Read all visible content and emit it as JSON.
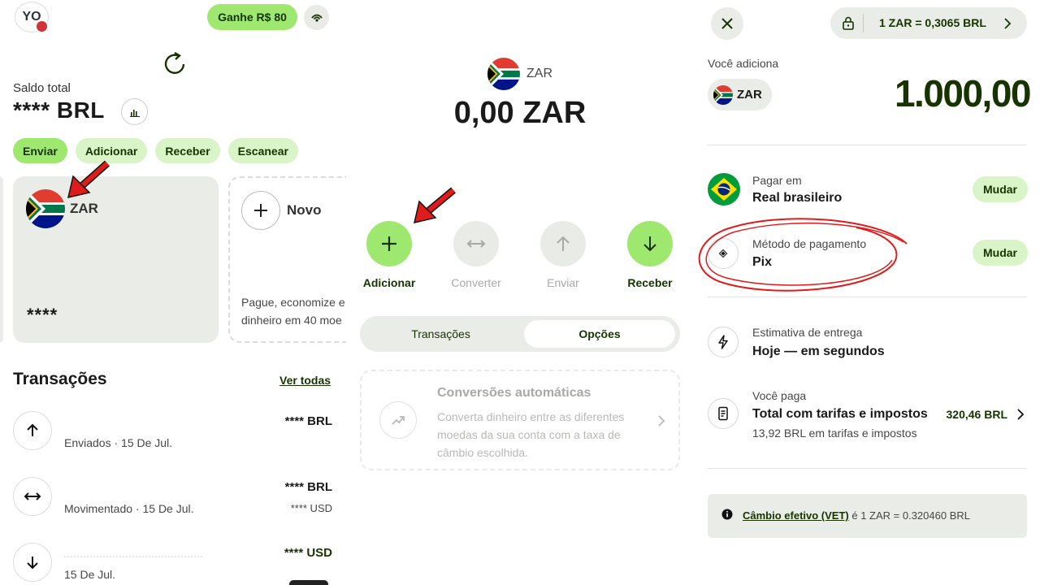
{
  "panel1": {
    "avatar_initials": "YO",
    "promo_label": "Ganhe R$ 80",
    "saldo_label": "Saldo total",
    "saldo_value": "**** BRL",
    "actions": [
      "Enviar",
      "Adicionar",
      "Receber",
      "Escanear"
    ],
    "account_card": {
      "currency": "ZAR",
      "balance": "****"
    },
    "novo_card": {
      "label": "Novo",
      "line1": "Pague, economize e",
      "line2": "dinheiro em 40 moe"
    },
    "transactions_title": "Transações",
    "ver_todas": "Ver todas",
    "transactions": [
      {
        "icon": "arrow-up-icon",
        "subtitle": "Enviados · 15 De Jul.",
        "amount": "**** BRL",
        "amount2": ""
      },
      {
        "icon": "swap-icon",
        "subtitle": "Movimentado · 15 De Jul.",
        "amount": "**** BRL",
        "amount2": "**** USD"
      },
      {
        "icon": "arrow-down-icon",
        "subtitle": "15 De Jul.",
        "amount": "**** USD",
        "amount2": ""
      }
    ]
  },
  "panel2": {
    "currency": "ZAR",
    "balance": "0,00 ZAR",
    "actions": [
      {
        "label": "Adicionar",
        "enabled": true
      },
      {
        "label": "Converter",
        "enabled": false
      },
      {
        "label": "Enviar",
        "enabled": false
      },
      {
        "label": "Receber",
        "enabled": true
      }
    ],
    "tabs": [
      "Transações",
      "Opções"
    ],
    "active_tab": "Opções",
    "auto_conversion": {
      "title": "Conversões automáticas",
      "line1": "Converta dinheiro entre as diferentes",
      "line2": "moedas da sua conta com a taxa de",
      "line3": "câmbio escolhida."
    }
  },
  "panel3": {
    "rate": "1 ZAR = 0,3065 BRL",
    "voce_adiciona": "Você adiciona",
    "currency": "ZAR",
    "amount": "1.000,00",
    "pagar_em_label": "Pagar em",
    "pagar_em_value": "Real brasileiro",
    "metodo_label": "Método de pagamento",
    "metodo_value": "Pix",
    "mudar": "Mudar",
    "entrega_label": "Estimativa de entrega",
    "entrega_value": "Hoje — em segundos",
    "voce_paga_label": "Você paga",
    "voce_paga_value": "Total com tarifas e impostos",
    "voce_paga_amount": "320,46 BRL",
    "fees_line": "13,92 BRL em tarifas e impostos",
    "vet_link": "Câmbio efetivo (VET)",
    "vet_text": " é 1 ZAR = 0.320460 BRL"
  },
  "colors": {
    "accent": "#9fe870",
    "accent_light": "#d9f5c8",
    "dark_green": "#163300",
    "annotation_red": "#e01b1b"
  }
}
